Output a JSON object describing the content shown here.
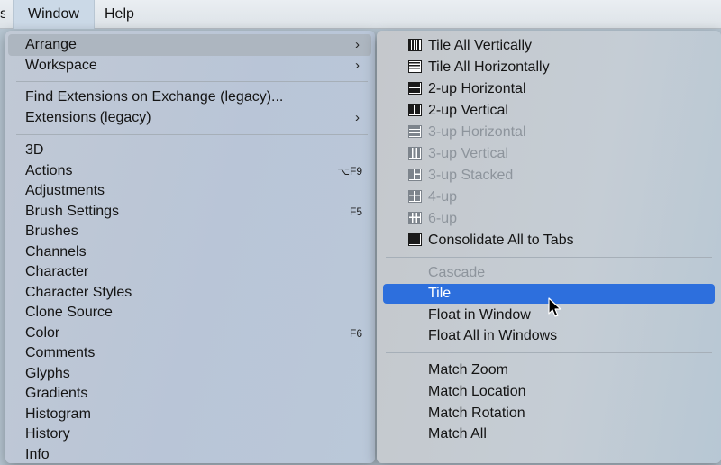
{
  "menubar": {
    "edge": "s",
    "window": "Window",
    "help": "Help"
  },
  "window_menu": {
    "arrange": "Arrange",
    "workspace": "Workspace",
    "find_extensions": "Find Extensions on Exchange (legacy)...",
    "extensions": "Extensions (legacy)",
    "items": [
      {
        "label": "3D",
        "shortcut": ""
      },
      {
        "label": "Actions",
        "shortcut": "⌥F9"
      },
      {
        "label": "Adjustments",
        "shortcut": ""
      },
      {
        "label": "Brush Settings",
        "shortcut": "F5"
      },
      {
        "label": "Brushes",
        "shortcut": ""
      },
      {
        "label": "Channels",
        "shortcut": ""
      },
      {
        "label": "Character",
        "shortcut": ""
      },
      {
        "label": "Character Styles",
        "shortcut": ""
      },
      {
        "label": "Clone Source",
        "shortcut": ""
      },
      {
        "label": "Color",
        "shortcut": "F6"
      },
      {
        "label": "Comments",
        "shortcut": ""
      },
      {
        "label": "Glyphs",
        "shortcut": ""
      },
      {
        "label": "Gradients",
        "shortcut": ""
      },
      {
        "label": "Histogram",
        "shortcut": ""
      },
      {
        "label": "History",
        "shortcut": ""
      },
      {
        "label": "Info",
        "shortcut": ""
      }
    ],
    "submenu_arrow": "›"
  },
  "arrange_menu": {
    "layouts": [
      {
        "label": "Tile All Vertically",
        "icon": "tile-vertical-icon",
        "enabled": true
      },
      {
        "label": "Tile All Horizontally",
        "icon": "tile-horizontal-icon",
        "enabled": true
      },
      {
        "label": "2-up Horizontal",
        "icon": "two-up-horizontal-icon",
        "enabled": true
      },
      {
        "label": "2-up Vertical",
        "icon": "two-up-vertical-icon",
        "enabled": true
      },
      {
        "label": "3-up Horizontal",
        "icon": "three-up-horizontal-icon",
        "enabled": false
      },
      {
        "label": "3-up Vertical",
        "icon": "three-up-vertical-icon",
        "enabled": false
      },
      {
        "label": "3-up Stacked",
        "icon": "three-up-stacked-icon",
        "enabled": false
      },
      {
        "label": "4-up",
        "icon": "four-up-icon",
        "enabled": false
      },
      {
        "label": "6-up",
        "icon": "six-up-icon",
        "enabled": false
      },
      {
        "label": "Consolidate All to Tabs",
        "icon": "consolidate-tabs-icon",
        "enabled": true
      }
    ],
    "cascade": "Cascade",
    "tile": "Tile",
    "float_in_window": "Float in Window",
    "float_all": "Float All in Windows",
    "match_zoom": "Match Zoom",
    "match_location": "Match Location",
    "match_rotation": "Match Rotation",
    "match_all": "Match All"
  },
  "colors": {
    "highlight": "#2d6fdd",
    "disabled_text": "#8d949c"
  }
}
